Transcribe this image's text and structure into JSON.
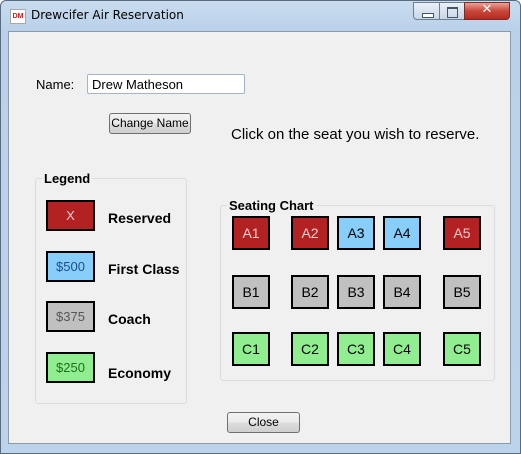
{
  "window": {
    "title": "Drewcifer Air Reservation",
    "icon_text": "DM",
    "close_glyph": "✕"
  },
  "form": {
    "name_label": "Name:",
    "name_value": "Drew Matheson",
    "change_name_button": "Change Name",
    "instructions": "Click on the seat you wish to reserve.",
    "close_button": "Close"
  },
  "legend": {
    "title": "Legend",
    "items": [
      {
        "swatch_text": "X",
        "label": "Reserved",
        "color": "#b22222",
        "text_color": "#ffcccc"
      },
      {
        "swatch_text": "$500",
        "label": "First Class",
        "color": "#87cefa",
        "text_color": "#1e4e8c"
      },
      {
        "swatch_text": "$375",
        "label": "Coach",
        "color": "#c0c0c0",
        "text_color": "#555555"
      },
      {
        "swatch_text": "$250",
        "label": "Economy",
        "color": "#90ee90",
        "text_color": "#1f6f1f"
      }
    ]
  },
  "seating": {
    "title": "Seating Chart",
    "colors": {
      "reserved": "#b22222",
      "first": "#87cefa",
      "coach": "#c0c0c0",
      "economy": "#90ee90"
    },
    "rows": [
      [
        {
          "label": "A1",
          "status": "reserved"
        },
        {
          "label": "A2",
          "status": "reserved"
        },
        {
          "label": "A3",
          "status": "first"
        },
        {
          "label": "A4",
          "status": "first"
        },
        {
          "label": "A5",
          "status": "reserved"
        }
      ],
      [
        {
          "label": "B1",
          "status": "coach"
        },
        {
          "label": "B2",
          "status": "coach"
        },
        {
          "label": "B3",
          "status": "coach"
        },
        {
          "label": "B4",
          "status": "coach"
        },
        {
          "label": "B5",
          "status": "coach"
        }
      ],
      [
        {
          "label": "C1",
          "status": "economy"
        },
        {
          "label": "C2",
          "status": "economy"
        },
        {
          "label": "C3",
          "status": "economy"
        },
        {
          "label": "C4",
          "status": "economy"
        },
        {
          "label": "C5",
          "status": "economy"
        }
      ]
    ]
  }
}
